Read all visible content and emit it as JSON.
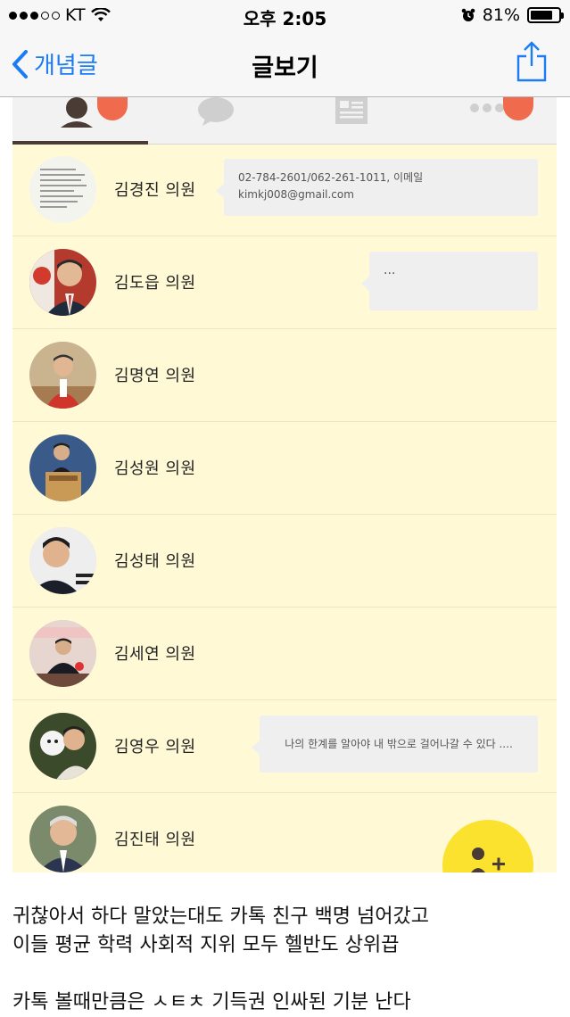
{
  "status_bar": {
    "carrier": "KT",
    "time": "오후 2:05",
    "battery": "81%",
    "battery_level": 0.81
  },
  "nav": {
    "back_label": "개념글",
    "title": "글보기",
    "share_icon": "share-icon"
  },
  "tabs": [
    {
      "icon": "person-icon",
      "active": true
    },
    {
      "icon": "chat-bubble-icon",
      "active": false
    },
    {
      "icon": "newsfeed-icon",
      "active": false
    },
    {
      "icon": "more-dots-icon",
      "active": false
    }
  ],
  "members": [
    {
      "name": "김경진 의원",
      "status": "02-784-2601/062-261-1011, 이메일\nkimkj008@gmail.com"
    },
    {
      "name": "김도읍 의원",
      "status": "..."
    },
    {
      "name": "김명연 의원",
      "status": ""
    },
    {
      "name": "김성원 의원",
      "status": ""
    },
    {
      "name": "김성태 의원",
      "status": ""
    },
    {
      "name": "김세연 의원",
      "status": ""
    },
    {
      "name": "김영우 의원",
      "status": "나의 한계를 알아야 내 밖으로 걸어나갈 수 있다 ...."
    },
    {
      "name": "김진태 의원",
      "status": ""
    }
  ],
  "fab_icon": "add-friend-icon",
  "post_text": {
    "line1": "귀찮아서 하다 말았는대도 카톡 친구 백명 넘어갔고",
    "line2": "이들 평균 학력 사회적 지위 모두 헬반도 상위끕",
    "line3": "카톡 볼때만큼은 ㅅㅌㅊ 기득권 인싸된 기분 난다"
  },
  "colors": {
    "ios_blue": "#1b7cf6",
    "kakao_bg": "#fff9d6",
    "badge": "#f06b4e",
    "fab": "#fbe22f"
  }
}
